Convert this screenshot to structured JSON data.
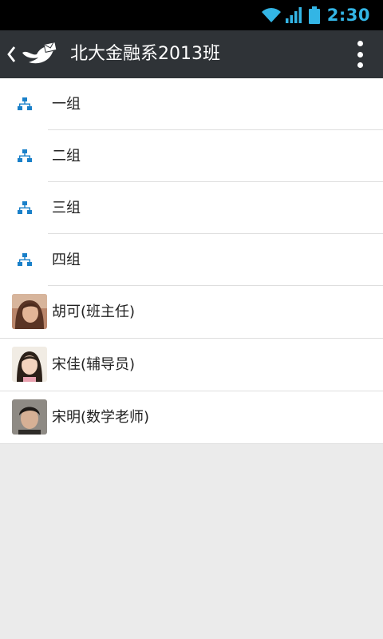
{
  "status_bar": {
    "time": "2:30",
    "wifi_icon": "wifi-icon",
    "signal_icon": "signal-icon",
    "battery_icon": "battery-icon",
    "accent_color": "#33b5e5"
  },
  "action_bar": {
    "back_icon": "chevron-left-icon",
    "logo_icon": "bird-mail-icon",
    "title": "北大金融系2013班",
    "menu_icon": "overflow-menu-icon"
  },
  "groups": [
    {
      "label": "一组",
      "icon": "org-chart-icon"
    },
    {
      "label": "二组",
      "icon": "org-chart-icon"
    },
    {
      "label": "三组",
      "icon": "org-chart-icon"
    },
    {
      "label": "四组",
      "icon": "org-chart-icon"
    }
  ],
  "contacts": [
    {
      "name": "胡可(班主任)",
      "avatar": "avatar-photo"
    },
    {
      "name": "宋佳(辅导员)",
      "avatar": "avatar-photo"
    },
    {
      "name": "宋明(数学老师)",
      "avatar": "avatar-photo"
    }
  ]
}
